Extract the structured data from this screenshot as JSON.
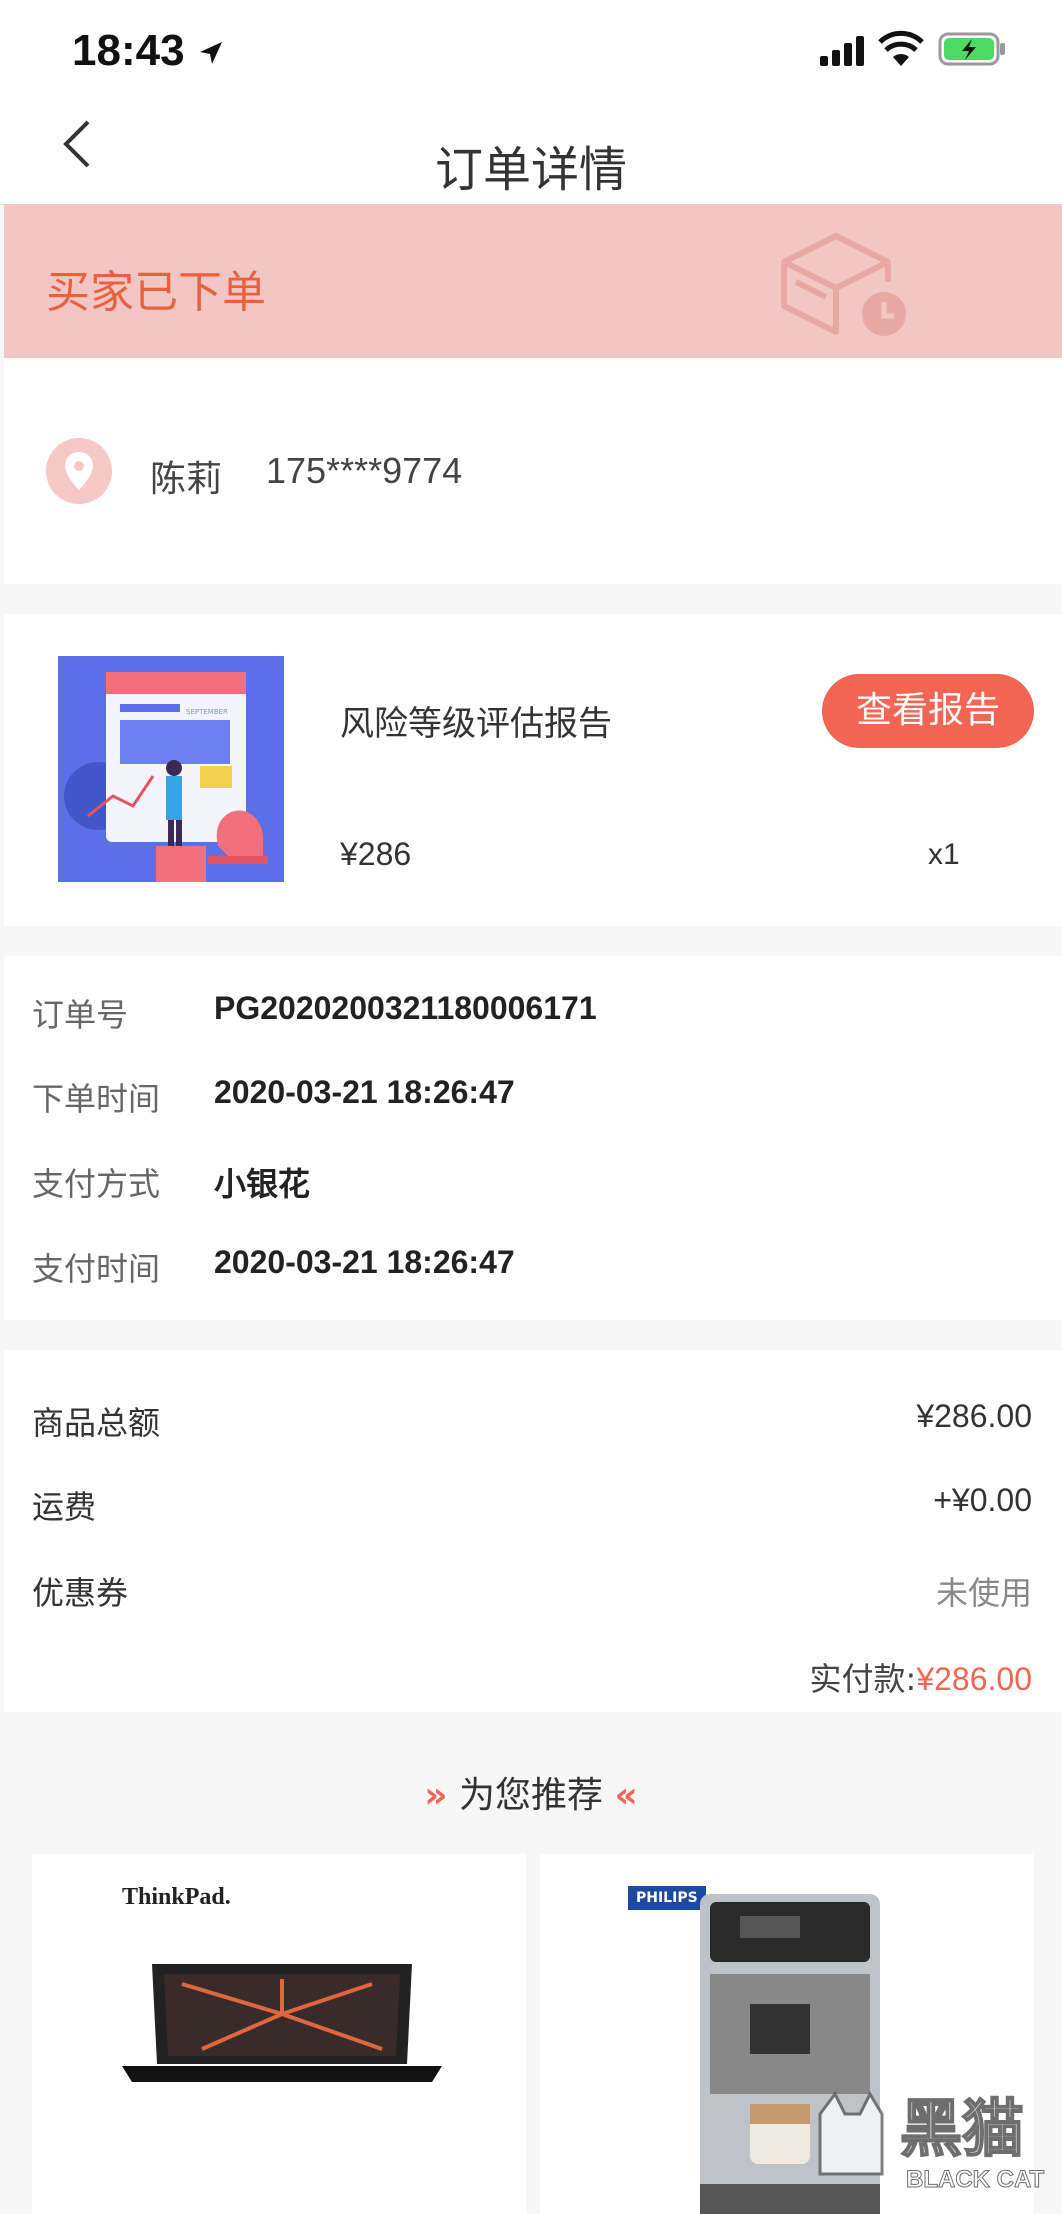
{
  "status_bar": {
    "time": "18:43"
  },
  "header": {
    "title": "订单详情"
  },
  "banner": {
    "status": "买家已下单"
  },
  "address": {
    "name": "陈莉",
    "phone": "175****9774"
  },
  "product": {
    "name": "风险等级评估报告",
    "button": "查看报告",
    "price": "¥286",
    "quantity": "x1",
    "image_caption": "SEPTEMBER"
  },
  "order_info": [
    {
      "label": "订单号",
      "value": "PG202020032118000617​1"
    },
    {
      "label": "下单时间",
      "value": "2020-03-21 18:26:47"
    },
    {
      "label": "支付方式",
      "value": "小银花"
    },
    {
      "label": "支付时间",
      "value": "2020-03-21 18:26:47"
    }
  ],
  "totals": {
    "goods_label": "商品总额",
    "goods_value": "¥286.00",
    "shipping_label": "运费",
    "shipping_value": "+¥0.00",
    "coupon_label": "优惠券",
    "coupon_value": "未使用",
    "paid_label": "实付款:",
    "paid_value": "¥286.00"
  },
  "recommend": {
    "title": "为您推荐",
    "items": [
      {
        "brand": "ThinkPad."
      },
      {
        "brand": "PHILIPS"
      }
    ]
  },
  "watermark": {
    "text_cn": "黑猫",
    "text_en": "BLACK CAT"
  },
  "colors": {
    "accent": "#f26552",
    "banner_bg": "#f2c6c4",
    "status_text": "#e8603c"
  }
}
